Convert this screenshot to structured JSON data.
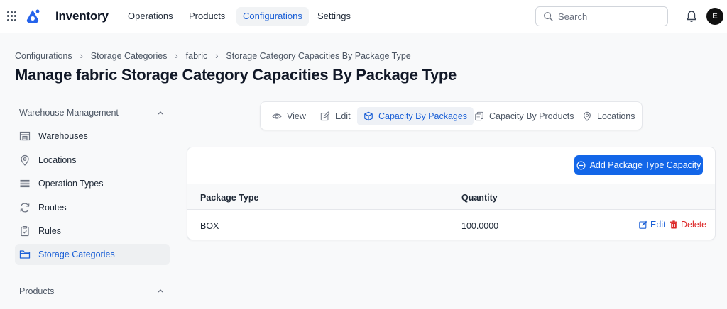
{
  "app": {
    "title": "Inventory"
  },
  "nav": {
    "items": [
      {
        "label": "Operations"
      },
      {
        "label": "Products"
      },
      {
        "label": "Configurations",
        "active": true
      },
      {
        "label": "Settings"
      }
    ]
  },
  "search": {
    "placeholder": "Search",
    "value": ""
  },
  "user": {
    "initial": "E"
  },
  "breadcrumb": [
    "Configurations",
    "Storage Categories",
    "fabric",
    "Storage Category Capacities By Package Type"
  ],
  "page": {
    "title": "Manage fabric Storage Category Capacities By Package Type"
  },
  "sidebar": {
    "groups": [
      {
        "label": "Warehouse Management"
      },
      {
        "label": "Products"
      }
    ],
    "items": [
      {
        "label": "Warehouses",
        "icon": "warehouse-icon"
      },
      {
        "label": "Locations",
        "icon": "map-pin-icon"
      },
      {
        "label": "Operation Types",
        "icon": "list-icon"
      },
      {
        "label": "Routes",
        "icon": "refresh-icon"
      },
      {
        "label": "Rules",
        "icon": "clipboard-icon"
      },
      {
        "label": "Storage Categories",
        "icon": "folder-icon",
        "active": true
      }
    ]
  },
  "tabs": [
    {
      "label": "View",
      "icon": "eye-icon"
    },
    {
      "label": "Edit",
      "icon": "pencil-icon"
    },
    {
      "label": "Capacity By Packages",
      "icon": "package-icon",
      "active": true
    },
    {
      "label": "Capacity By Products",
      "icon": "copy-icon"
    },
    {
      "label": "Locations",
      "icon": "map-pin-icon"
    }
  ],
  "card": {
    "add_button": "Add Package Type Capacity",
    "columns": [
      "Package Type",
      "Quantity"
    ],
    "rows": [
      {
        "package_type": "BOX",
        "quantity": "100.0000",
        "edit": "Edit",
        "delete": "Delete"
      }
    ]
  },
  "colors": {
    "accent": "#1366e8",
    "active_text": "#1a5fd6",
    "danger": "#dc2626"
  }
}
